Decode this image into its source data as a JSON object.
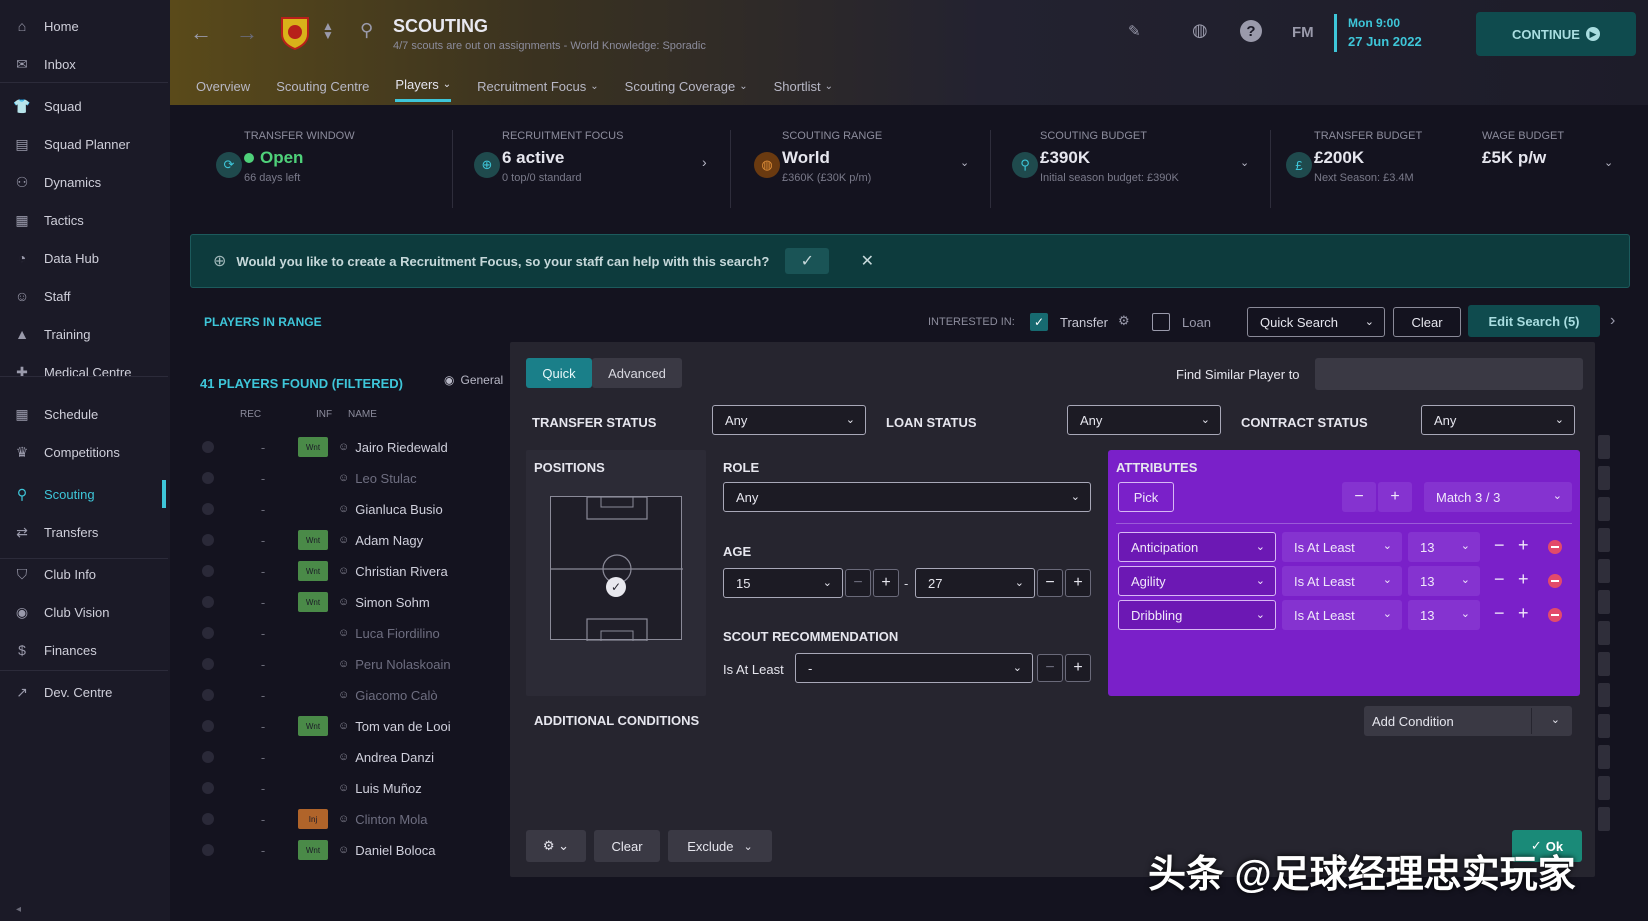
{
  "sidebar": {
    "items": [
      {
        "label": "Home",
        "icon": "home-icon",
        "glyph": "⌂"
      },
      {
        "label": "Inbox",
        "icon": "inbox-icon",
        "glyph": "✉"
      },
      {
        "label": "Squad",
        "icon": "shirt-icon",
        "glyph": "👕"
      },
      {
        "label": "Squad Planner",
        "icon": "planner-icon",
        "glyph": "▤"
      },
      {
        "label": "Dynamics",
        "icon": "dynamics-icon",
        "glyph": "⚇"
      },
      {
        "label": "Tactics",
        "icon": "tactics-icon",
        "glyph": "▦"
      },
      {
        "label": "Data Hub",
        "icon": "data-hub-icon",
        "glyph": "◔"
      },
      {
        "label": "Staff",
        "icon": "staff-icon",
        "glyph": "☺"
      },
      {
        "label": "Training",
        "icon": "training-icon",
        "glyph": "▲"
      },
      {
        "label": "Medical Centre",
        "icon": "medical-icon",
        "glyph": "✚"
      },
      {
        "label": "Schedule",
        "icon": "calendar-icon",
        "glyph": "▦"
      },
      {
        "label": "Competitions",
        "icon": "trophy-icon",
        "glyph": "♛"
      },
      {
        "label": "Scouting",
        "icon": "search-icon",
        "glyph": "⚲"
      },
      {
        "label": "Transfers",
        "icon": "transfer-icon",
        "glyph": "⇄"
      },
      {
        "label": "Club Info",
        "icon": "shield-icon",
        "glyph": "⛉"
      },
      {
        "label": "Club Vision",
        "icon": "vision-icon",
        "glyph": "◉"
      },
      {
        "label": "Finances",
        "icon": "finance-icon",
        "glyph": "$"
      },
      {
        "label": "Dev. Centre",
        "icon": "dev-centre-icon",
        "glyph": "↗"
      }
    ]
  },
  "header": {
    "title": "SCOUTING",
    "subtitle": "4/7 scouts are out on assignments - World Knowledge: Sporadic",
    "fm_label": "FM",
    "date_line1": "Mon 9:00",
    "date_line2": "27 Jun 2022",
    "continue_label": "CONTINUE",
    "tabs": [
      "Overview",
      "Scouting Centre",
      "Players",
      "Recruitment Focus",
      "Scouting Coverage",
      "Shortlist"
    ],
    "active_tab": "Players"
  },
  "stats": {
    "transfer_window": {
      "label": "TRANSFER WINDOW",
      "value": "Open",
      "sub": "66 days left"
    },
    "recruitment_focus": {
      "label": "RECRUITMENT FOCUS",
      "value": "6 active",
      "sub": "0 top/0 standard"
    },
    "scouting_range": {
      "label": "SCOUTING RANGE",
      "value": "World",
      "sub": "£360K (£30K p/m)"
    },
    "scouting_budget": {
      "label": "SCOUTING BUDGET",
      "value": "£390K",
      "sub": "Initial season budget: £390K"
    },
    "transfer_budget": {
      "label": "TRANSFER BUDGET",
      "value": "£200K",
      "sub": "Next Season: £3.4M"
    },
    "wage_budget": {
      "label": "WAGE BUDGET",
      "value": "£5K p/w"
    }
  },
  "banner": {
    "text": "Would you like to create a Recruitment Focus, so your staff can help with this search?"
  },
  "players_bar": {
    "title": "PLAYERS IN RANGE",
    "interested_in": "INTERESTED IN:",
    "transfer": "Transfer",
    "loan": "Loan",
    "quick_search": "Quick Search",
    "clear": "Clear",
    "edit_search": "Edit Search (5)"
  },
  "list": {
    "count": "41 PLAYERS FOUND (FILTERED)",
    "view": "General",
    "col_rec": "REC",
    "col_inf": "INF",
    "col_name": "NAME",
    "players": [
      {
        "name": "Jairo Riedewald",
        "rec": "-",
        "inf": "Wnt",
        "dim": false
      },
      {
        "name": "Leo Stulac",
        "rec": "-",
        "inf": "",
        "dim": true
      },
      {
        "name": "Gianluca Busio",
        "rec": "-",
        "inf": "",
        "dim": false
      },
      {
        "name": "Adam Nagy",
        "rec": "-",
        "inf": "Wnt",
        "dim": false
      },
      {
        "name": "Christian Rivera",
        "rec": "-",
        "inf": "Wnt",
        "dim": false
      },
      {
        "name": "Simon Sohm",
        "rec": "-",
        "inf": "Wnt",
        "dim": false
      },
      {
        "name": "Luca Fiordilino",
        "rec": "-",
        "inf": "",
        "dim": true
      },
      {
        "name": "Peru Nolaskoain",
        "rec": "-",
        "inf": "",
        "dim": true
      },
      {
        "name": "Giacomo Calò",
        "rec": "-",
        "inf": "",
        "dim": true
      },
      {
        "name": "Tom van de Looi",
        "rec": "-",
        "inf": "Wnt",
        "dim": false
      },
      {
        "name": "Andrea Danzi",
        "rec": "-",
        "inf": "",
        "dim": false
      },
      {
        "name": "Luis Muñoz",
        "rec": "-",
        "inf": "",
        "dim": false
      },
      {
        "name": "Clinton Mola",
        "rec": "-",
        "inf": "Inj",
        "dim": true
      },
      {
        "name": "Daniel Boloca",
        "rec": "-",
        "inf": "Wnt",
        "dim": false
      }
    ]
  },
  "search": {
    "quick": "Quick",
    "advanced": "Advanced",
    "find_similar": "Find Similar Player to",
    "transfer_status_label": "TRANSFER STATUS",
    "transfer_status": "Any",
    "loan_status_label": "LOAN STATUS",
    "loan_status": "Any",
    "contract_status_label": "CONTRACT STATUS",
    "contract_status": "Any",
    "positions_label": "POSITIONS",
    "role_label": "ROLE",
    "role": "Any",
    "age_label": "AGE",
    "age_min": "15",
    "age_sep": "-",
    "age_max": "27",
    "scout_rec_label": "SCOUT RECOMMENDATION",
    "scout_rec_op": "Is At Least",
    "scout_rec_value": "-",
    "additional_label": "ADDITIONAL CONDITIONS",
    "add_condition": "Add Condition",
    "attributes_label": "ATTRIBUTES",
    "pick": "Pick",
    "match": "Match 3 / 3",
    "attributes": [
      {
        "name": "Anticipation",
        "op": "Is At Least",
        "value": "13"
      },
      {
        "name": "Agility",
        "op": "Is At Least",
        "value": "13"
      },
      {
        "name": "Dribbling",
        "op": "Is At Least",
        "value": "13"
      }
    ],
    "clear": "Clear",
    "exclude": "Exclude",
    "ok": "Ok"
  },
  "watermark": "头条 @足球经理忠实玩家",
  "colors": {
    "accent": "#3ec6d9",
    "attributes_bg": "#7a20c9",
    "banner_bg": "#0d3b3d"
  }
}
